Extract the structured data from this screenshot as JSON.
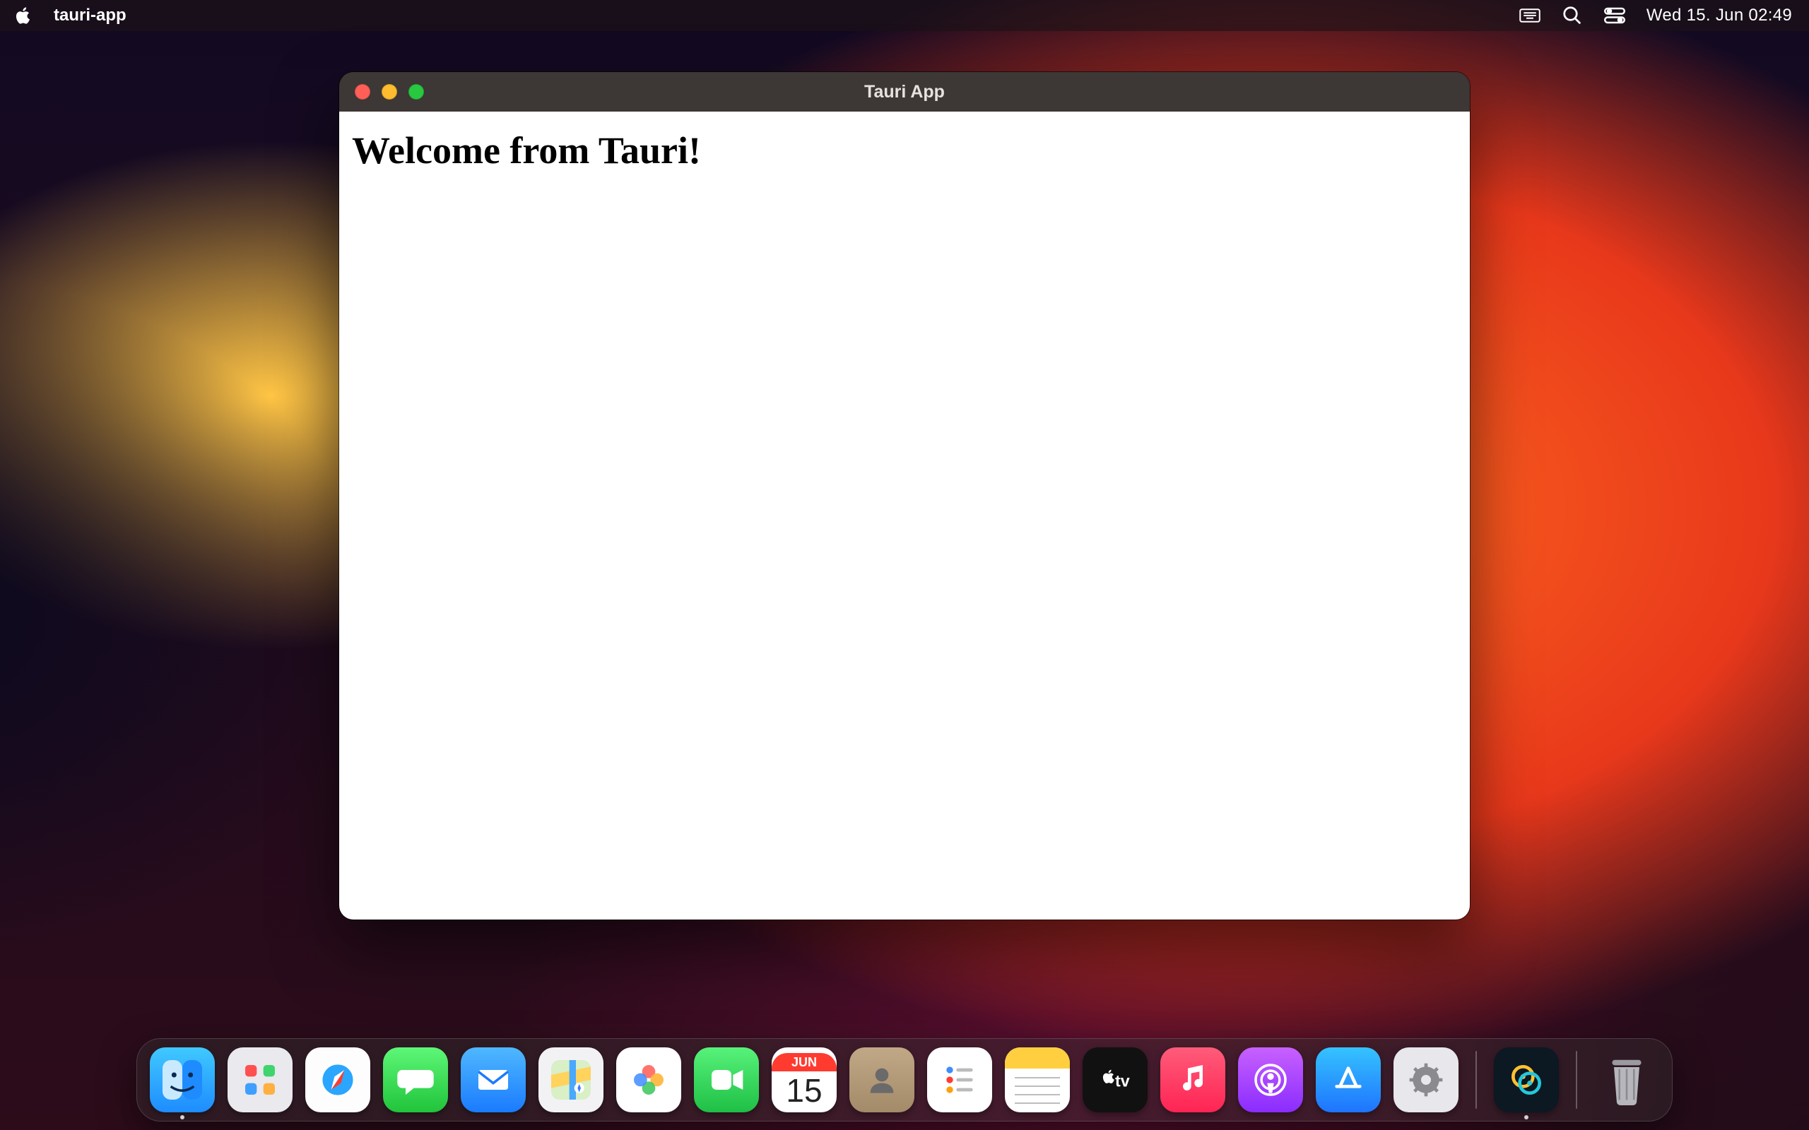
{
  "menubar": {
    "app_name": "tauri-app",
    "datetime": "Wed 15. Jun  02:49",
    "status_icons": [
      "keyboard-viewer-icon",
      "search-icon",
      "control-center-icon"
    ]
  },
  "window": {
    "title": "Tauri App",
    "heading": "Welcome from Tauri!"
  },
  "calendar": {
    "month": "JUN",
    "day": "15"
  },
  "dock": {
    "apps": [
      {
        "name": "finder",
        "label": "Finder",
        "running": true
      },
      {
        "name": "launchpad",
        "label": "Launchpad",
        "running": false
      },
      {
        "name": "safari",
        "label": "Safari",
        "running": false
      },
      {
        "name": "messages",
        "label": "Messages",
        "running": false
      },
      {
        "name": "mail",
        "label": "Mail",
        "running": false
      },
      {
        "name": "maps",
        "label": "Maps",
        "running": false
      },
      {
        "name": "photos",
        "label": "Photos",
        "running": false
      },
      {
        "name": "facetime",
        "label": "FaceTime",
        "running": false
      },
      {
        "name": "calendar",
        "label": "Calendar",
        "running": false
      },
      {
        "name": "contacts",
        "label": "Contacts",
        "running": false
      },
      {
        "name": "reminders",
        "label": "Reminders",
        "running": false
      },
      {
        "name": "notes",
        "label": "Notes",
        "running": false
      },
      {
        "name": "tv",
        "label": "TV",
        "running": false
      },
      {
        "name": "music",
        "label": "Music",
        "running": false
      },
      {
        "name": "podcasts",
        "label": "Podcasts",
        "running": false
      },
      {
        "name": "appstore",
        "label": "App Store",
        "running": false
      },
      {
        "name": "settings",
        "label": "System Settings",
        "running": false
      },
      {
        "name": "tauri",
        "label": "tauri-app",
        "running": true
      }
    ],
    "trash_label": "Trash"
  }
}
